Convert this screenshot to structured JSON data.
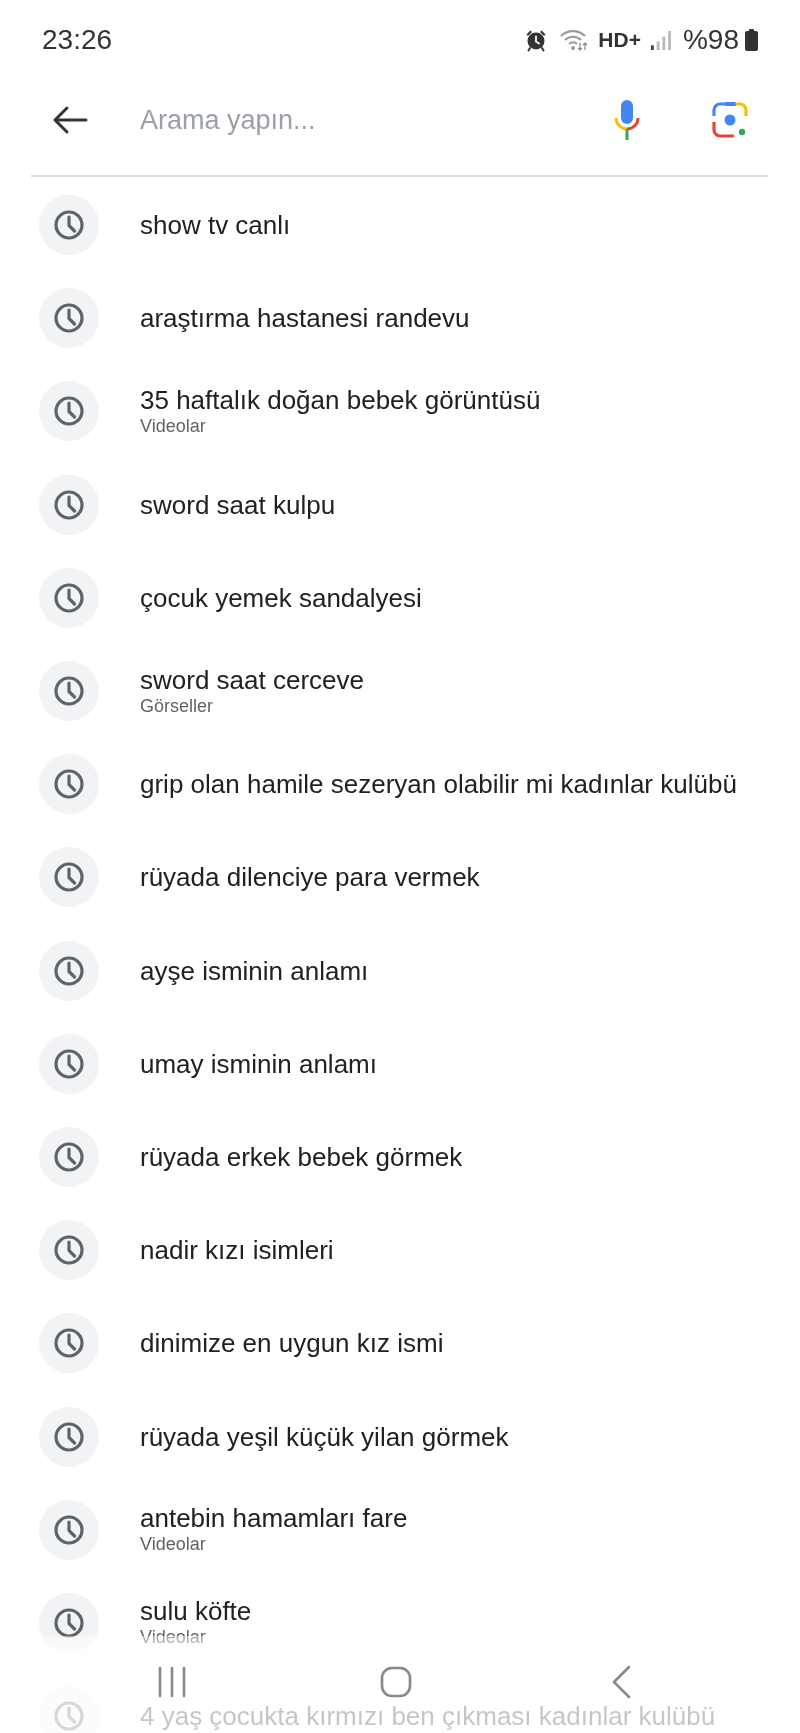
{
  "status_bar": {
    "time": "23:26",
    "hd_indicator": "HD+",
    "battery_percent": "%98"
  },
  "search": {
    "placeholder": "Arama yapın..."
  },
  "history": [
    {
      "query": "show tv canlı"
    },
    {
      "query": "araştırma hastanesi randevu"
    },
    {
      "query": "35 haftalık doğan bebek görüntüsü",
      "category": "Videolar"
    },
    {
      "query": "sword saat kulpu"
    },
    {
      "query": "çocuk yemek sandalyesi"
    },
    {
      "query": "sword saat cerceve",
      "category": "Görseller"
    },
    {
      "query": "grip olan hamile sezeryan olabilir mi kadınlar kulübü"
    },
    {
      "query": "rüyada dilenciye para vermek"
    },
    {
      "query": "ayşe isminin anlamı"
    },
    {
      "query": "umay isminin anlamı"
    },
    {
      "query": "rüyada erkek bebek görmek"
    },
    {
      "query": "nadir kızı isimleri"
    },
    {
      "query": "dinimize en uygun kız ismi"
    },
    {
      "query": "rüyada yeşil küçük yilan görmek"
    },
    {
      "query": "antebin hamamları fare",
      "category": "Videolar"
    },
    {
      "query": "sulu köfte",
      "category": "Videolar"
    },
    {
      "query": "4 yaş çocukta kırmızı ben çıkması kadınlar kulübü"
    }
  ]
}
